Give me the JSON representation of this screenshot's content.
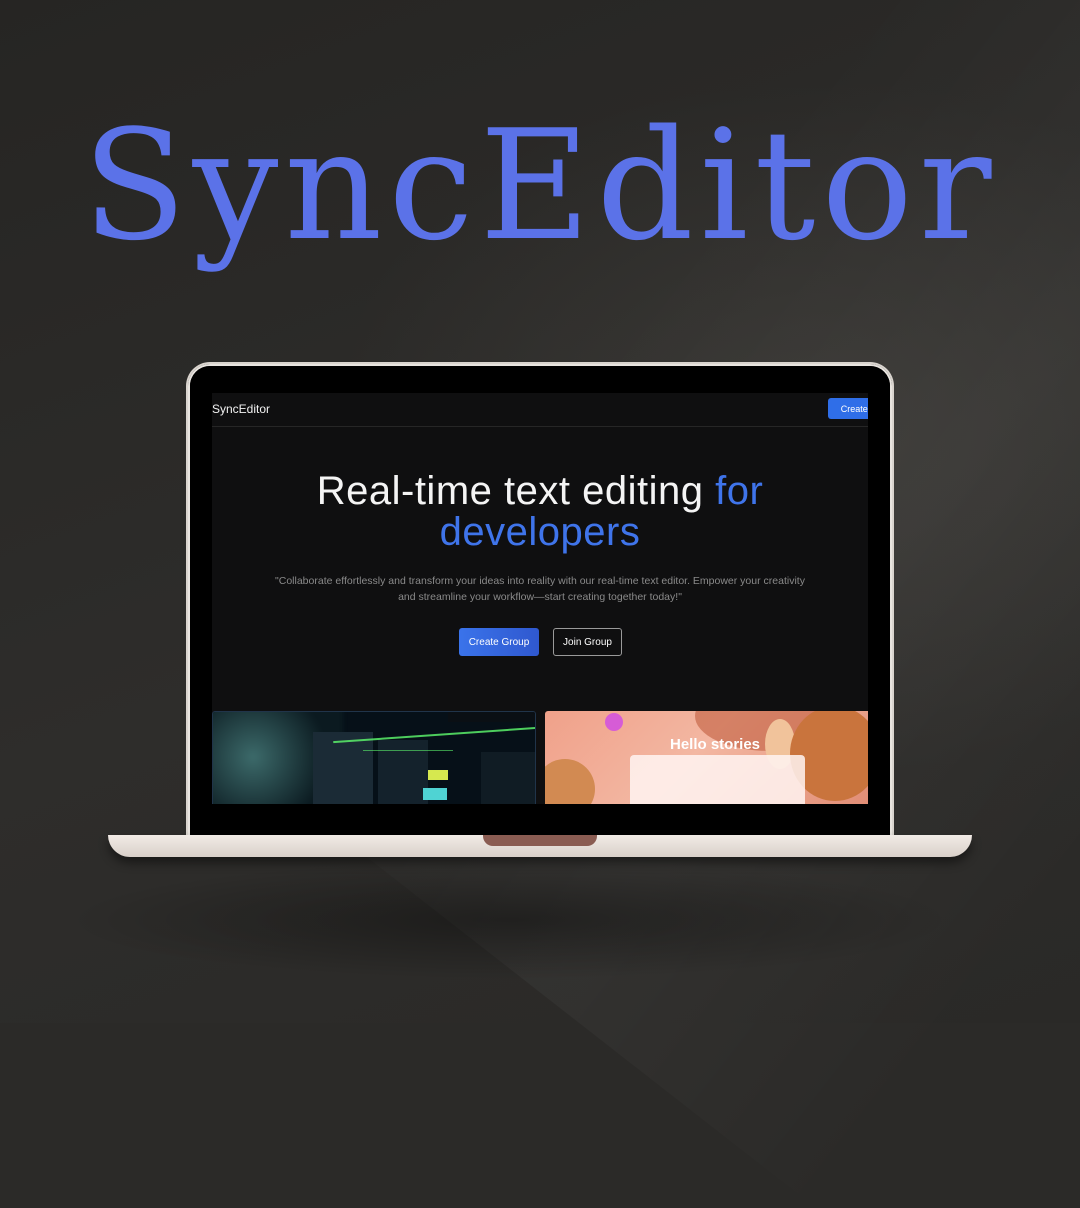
{
  "brand": {
    "title": "SyncEditor",
    "color": "#5b72e8"
  },
  "app": {
    "nav": {
      "logo": "SyncEditor",
      "cta": "Create Group"
    },
    "hero": {
      "line1_main": "Real-time text editing ",
      "line1_accent": "for",
      "line2": "developers",
      "accent_color": "#3f74ea"
    },
    "quote": "\"Collaborate effortlessly and transform your ideas into reality with our real-time text editor. Empower your creativity and streamline your workflow—start creating together today!\"",
    "buttons": {
      "create": "Create Group",
      "join": "Join Group"
    },
    "cards": {
      "left": {
        "icon": "terminal-code-image"
      },
      "right": {
        "caption": "Hello stories",
        "icon": "stories-illustration"
      }
    }
  }
}
